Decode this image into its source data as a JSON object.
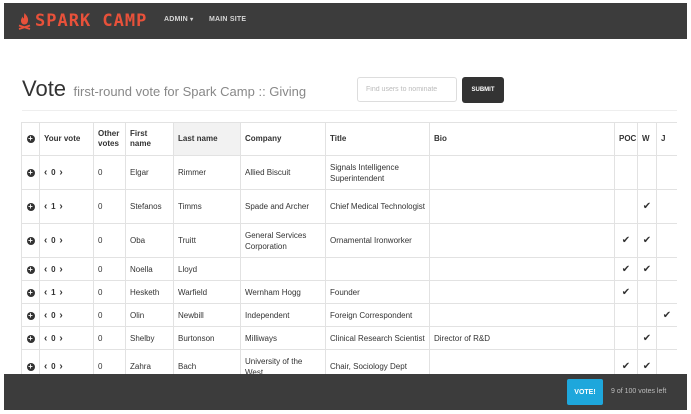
{
  "navbar": {
    "brand": "SPARK CAMP",
    "admin_label": "ADMIN",
    "main_site_label": "MAIN SITE",
    "brand_color": "#e8513a",
    "background": "#3c3c3c"
  },
  "header": {
    "title": "Vote",
    "subtitle": "first-round vote for Spark Camp :: Giving"
  },
  "search": {
    "placeholder": "Find users to nominate",
    "value": ""
  },
  "submit_label": "SUBMIT",
  "table": {
    "columns": [
      "",
      "Your vote",
      "Other votes",
      "First name",
      "Last name",
      "Company",
      "Title",
      "Bio",
      "POC",
      "W",
      "J"
    ],
    "rows": [
      {
        "vote": "0",
        "other": "0",
        "first": "Elgar",
        "last": "Rimmer",
        "company": "Allied Biscuit",
        "title": "Signals Intelligence Superintendent",
        "bio": "",
        "poc": "",
        "w": "",
        "j": ""
      },
      {
        "vote": "1",
        "other": "0",
        "first": "Stefanos",
        "last": "Timms",
        "company": "Spade and Archer",
        "title": "Chief Medical Technologist",
        "bio": "",
        "poc": "",
        "w": "✔",
        "j": ""
      },
      {
        "vote": "0",
        "other": "0",
        "first": "Oba",
        "last": "Truitt",
        "company": "General Services Corporation",
        "title": "Ornamental Ironworker",
        "bio": "",
        "poc": "✔",
        "w": "✔",
        "j": ""
      },
      {
        "vote": "0",
        "other": "0",
        "first": "Noella",
        "last": "Lloyd",
        "company": "",
        "title": "",
        "bio": "",
        "poc": "✔",
        "w": "✔",
        "j": ""
      },
      {
        "vote": "1",
        "other": "0",
        "first": "Hesketh",
        "last": "Warfield",
        "company": "Wernham Hogg",
        "title": "Founder",
        "bio": "",
        "poc": "✔",
        "w": "",
        "j": ""
      },
      {
        "vote": "0",
        "other": "0",
        "first": "Olin",
        "last": "Newbill",
        "company": "Independent",
        "title": "Foreign Correspondent",
        "bio": "",
        "poc": "",
        "w": "",
        "j": "✔"
      },
      {
        "vote": "0",
        "other": "0",
        "first": "Shelby",
        "last": "Burtonson",
        "company": "Milliways",
        "title": "Clinical Research Scientist",
        "bio": "Director of R&D",
        "poc": "",
        "w": "✔",
        "j": ""
      },
      {
        "vote": "0",
        "other": "0",
        "first": "Zahra",
        "last": "Bach",
        "company": "University of the West",
        "title": "Chair, Sociology Dept",
        "bio": "",
        "poc": "✔",
        "w": "✔",
        "j": ""
      }
    ]
  },
  "footer": {
    "vote_button": "VOTE!",
    "votes_left": "9 of 100 votes left",
    "accent": "#1ea7dc"
  }
}
